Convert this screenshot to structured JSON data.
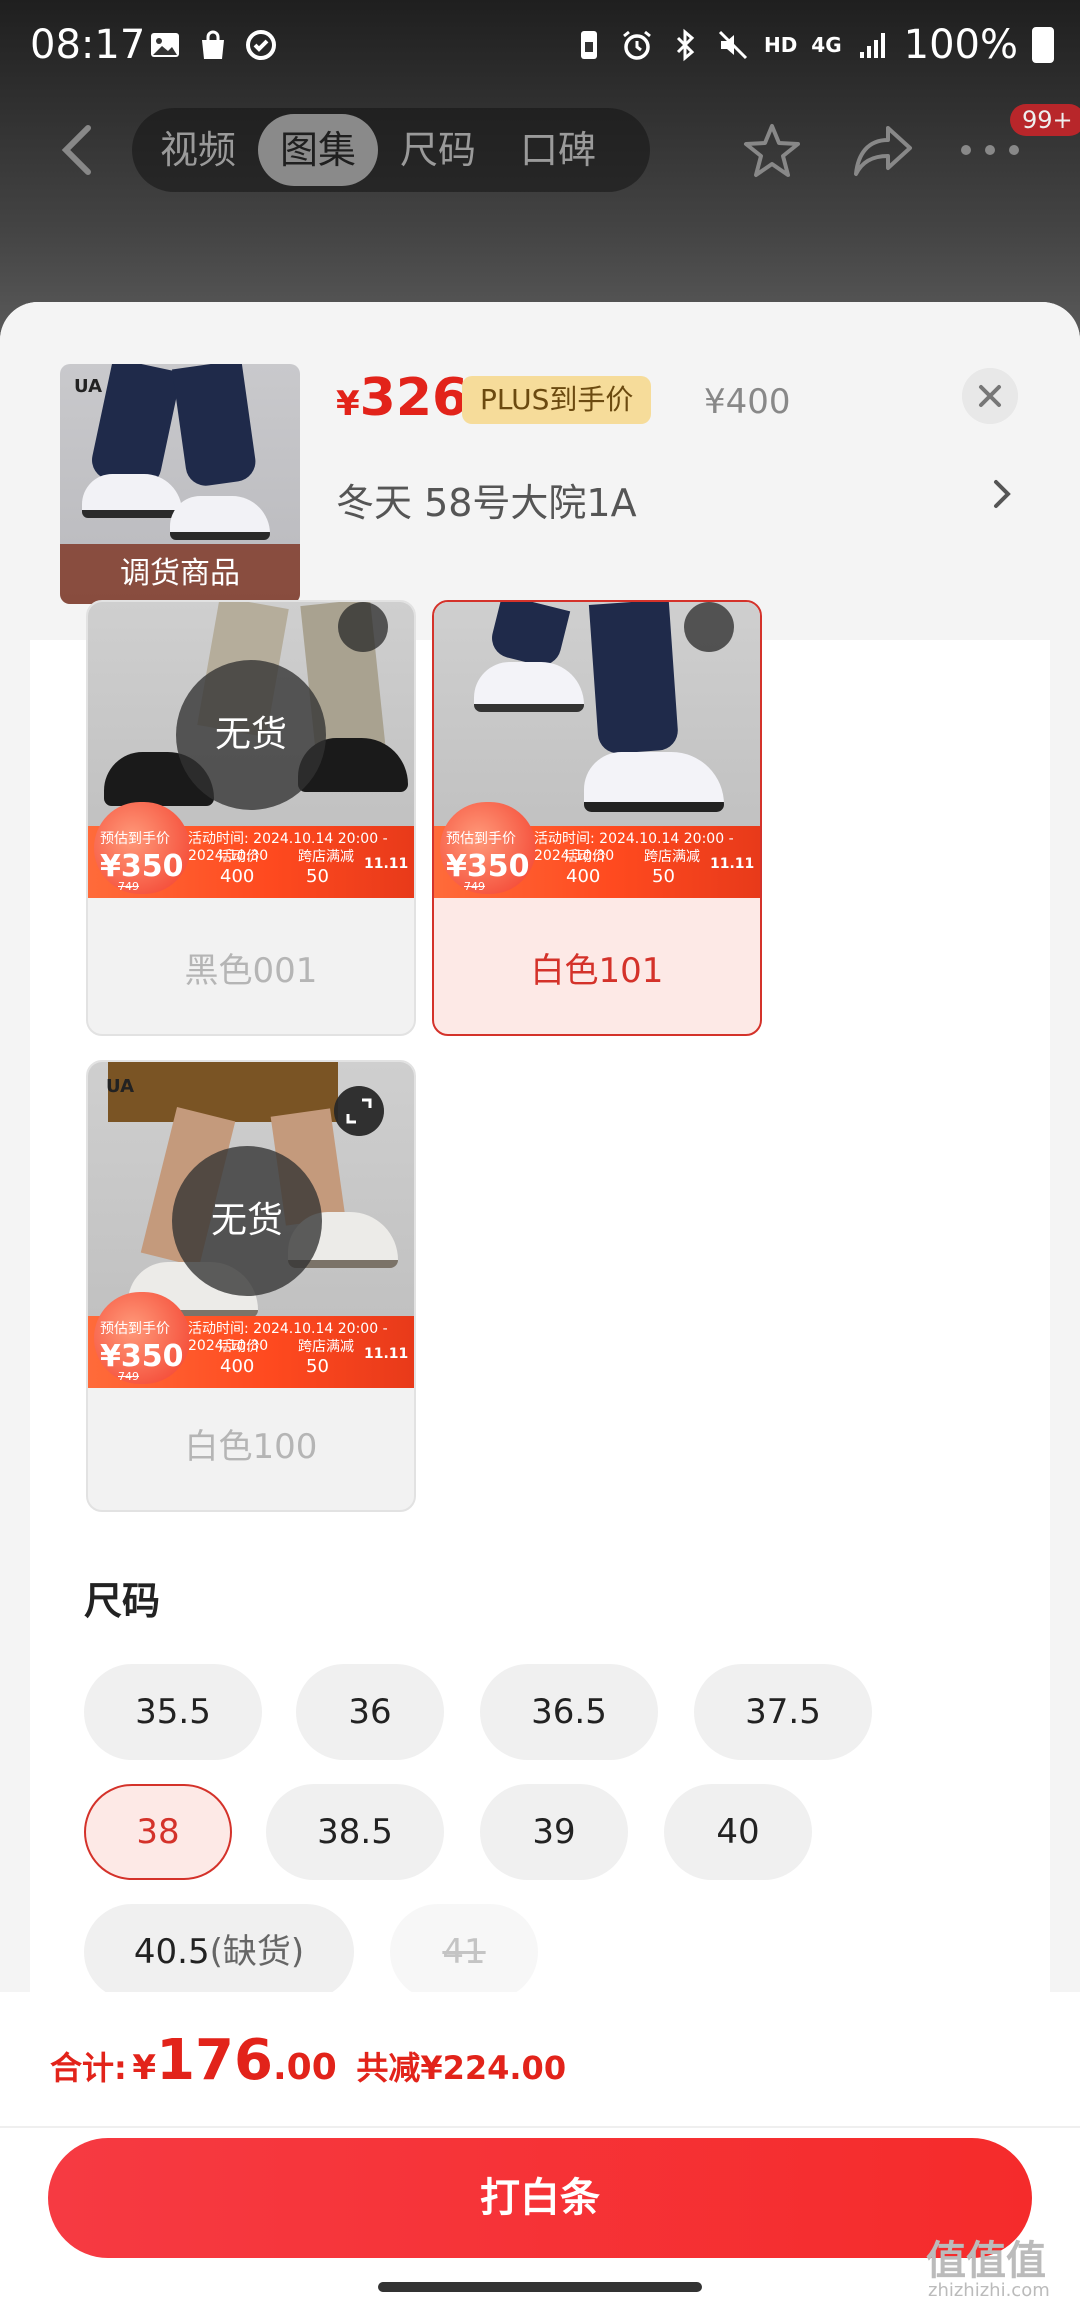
{
  "status_bar": {
    "time": "08:17",
    "hd_label": "HD",
    "network_label": "4G",
    "battery": "100%"
  },
  "nav": {
    "tabs": [
      {
        "label": "视频"
      },
      {
        "label": "图集"
      },
      {
        "label": "尺码"
      },
      {
        "label": "口碑"
      }
    ],
    "active_tab": "图集",
    "badge": "99+"
  },
  "product": {
    "thumb_banner": "调货商品",
    "thumb_logo": "UA",
    "price_currency": "¥",
    "price": "326",
    "plus_tag": "PLUS到手价",
    "original_price": "¥400",
    "address": "冬天  58号大院1A"
  },
  "colors": [
    {
      "label": "黑色001",
      "out_of_stock": true,
      "stock_badge": "无货",
      "promo": {
        "tag": "预估到手价",
        "price": "¥350",
        "activity": "活动时间: 2024.10.14 20:00 - 2024.10.30",
        "col1_title": "活动价",
        "col1_value": "400",
        "col2_title": "跨店满减",
        "col2_value": "50",
        "was": "749",
        "event": "11.11"
      }
    },
    {
      "label": "白色101",
      "out_of_stock": false,
      "selected": true,
      "promo": {
        "tag": "预估到手价",
        "price": "¥350",
        "activity": "活动时间: 2024.10.14 20:00 - 2024.10.30",
        "col1_title": "活动价",
        "col1_value": "400",
        "col2_title": "跨店满减",
        "col2_value": "50",
        "was": "749",
        "event": "11.11"
      }
    },
    {
      "label": "白色100",
      "out_of_stock": true,
      "stock_badge": "无货",
      "promo": {
        "tag": "预估到手价",
        "price": "¥350",
        "activity": "活动时间: 2024.10.14 20:00 - 2024.10.30",
        "col1_title": "活动价",
        "col1_value": "400",
        "col2_title": "跨店满减",
        "col2_value": "50",
        "was": "749",
        "event": "11.11"
      }
    }
  ],
  "sizes_title": "尺码",
  "sizes": [
    {
      "label": "35.5",
      "state": "normal"
    },
    {
      "label": "36",
      "state": "normal"
    },
    {
      "label": "36.5",
      "state": "normal"
    },
    {
      "label": "37.5",
      "state": "normal"
    },
    {
      "label": "38",
      "state": "selected"
    },
    {
      "label": "38.5",
      "state": "normal"
    },
    {
      "label": "39",
      "state": "normal"
    },
    {
      "label": "40",
      "state": "normal"
    },
    {
      "label": "40.5",
      "suffix": "(缺货)",
      "state": "low_stock"
    },
    {
      "label": "41",
      "state": "disabled"
    }
  ],
  "footer": {
    "total_label": "合计:",
    "currency": "¥",
    "total_int": "176",
    "total_dec": ".00",
    "discount": "共减¥224.00",
    "pay_button": "打白条"
  },
  "watermark": {
    "main": "值值值",
    "sub": "zhizhizhi.com"
  },
  "colors_theme": {
    "accent": "#e2231a",
    "plus": "#f6dc9a",
    "selected_bg": "#fde9e6"
  }
}
